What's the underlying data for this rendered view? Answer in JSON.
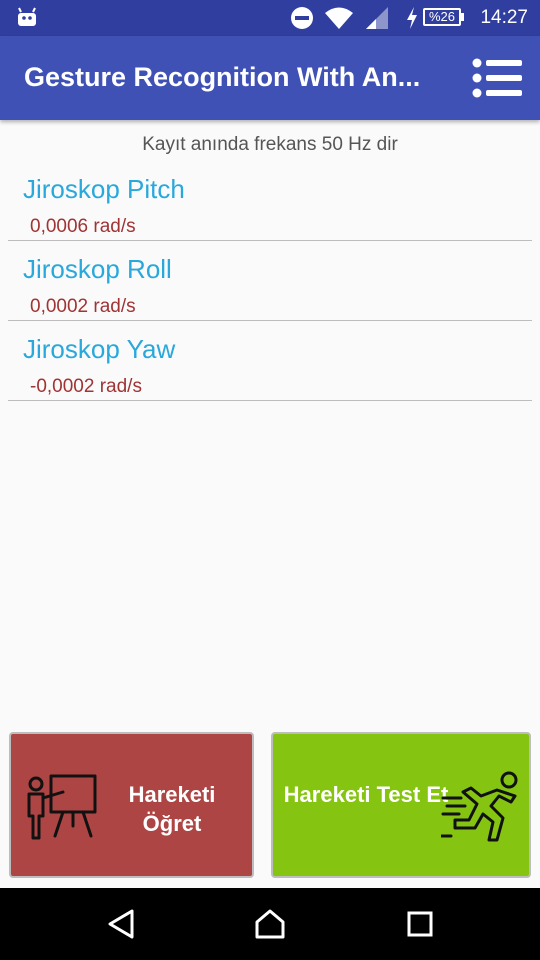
{
  "status_bar": {
    "time": "14:27",
    "battery": "%26",
    "icons": [
      "android-icon",
      "do-not-disturb-icon",
      "wifi-icon",
      "signal-icon",
      "charging-icon",
      "battery-icon"
    ]
  },
  "toolbar": {
    "title": "Gesture Recognition With An...",
    "menu_icon": "list-menu-icon"
  },
  "frequency_text": "Kayıt anında frekans 50 Hz dir",
  "sensors": [
    {
      "name": "Jiroskop Pitch",
      "value": "0,0006 rad/s"
    },
    {
      "name": "Jiroskop Roll",
      "value": "0,0002 rad/s"
    },
    {
      "name": "Jiroskop Yaw",
      "value": "-0,0002 rad/s"
    }
  ],
  "buttons": {
    "teach": {
      "label": "Hareketi Öğret",
      "icon": "teacher-board-icon",
      "color": "#ae4545"
    },
    "test": {
      "label": "Hareketi Test Et",
      "icon": "running-man-icon",
      "color": "#86c412"
    }
  },
  "nav_bar": {
    "icons": [
      "back-icon",
      "home-icon",
      "recents-icon"
    ]
  },
  "colors": {
    "primary": "#3f51b5",
    "primary_dark": "#303f9f",
    "sensor_name": "#29a8dc",
    "sensor_value": "#a03434"
  }
}
